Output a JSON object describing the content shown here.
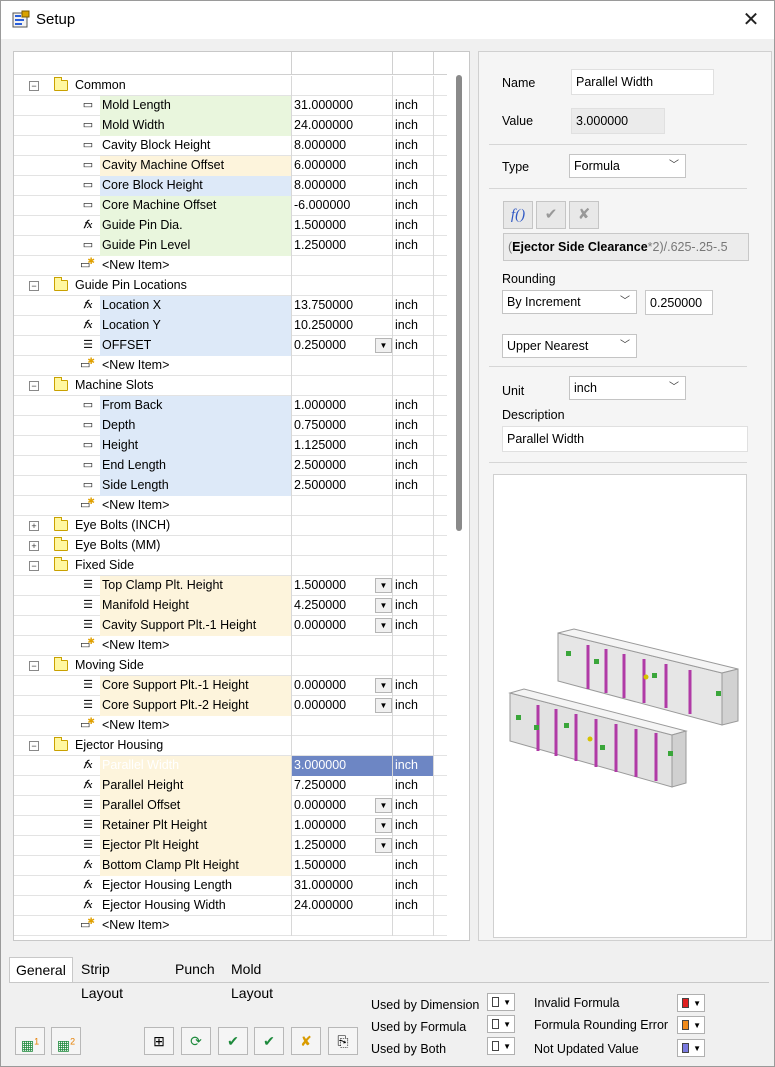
{
  "window": {
    "title": "Setup"
  },
  "grid": {
    "rows": [
      {
        "kind": "group",
        "level": 0,
        "label": "Common",
        "open": true
      },
      {
        "kind": "item",
        "label": "Mold Length",
        "value": "31.000000",
        "unit": "inch",
        "icon": "dim",
        "bg": "#e9f6dd"
      },
      {
        "kind": "item",
        "label": "Mold Width",
        "value": "24.000000",
        "unit": "inch",
        "icon": "dim",
        "bg": "#e9f6dd"
      },
      {
        "kind": "item",
        "label": "Cavity Block Height",
        "value": "8.000000",
        "unit": "inch",
        "icon": "dim",
        "bg": ""
      },
      {
        "kind": "item",
        "label": "Cavity Machine Offset",
        "value": "6.000000",
        "unit": "inch",
        "icon": "dim",
        "bg": "#fdf4dc"
      },
      {
        "kind": "item",
        "label": "Core Block Height",
        "value": "8.000000",
        "unit": "inch",
        "icon": "dim",
        "bg": "#dde9f8"
      },
      {
        "kind": "item",
        "label": "Core Machine Offset",
        "value": "-6.000000",
        "unit": "inch",
        "icon": "dim",
        "bg": "#e9f6dd"
      },
      {
        "kind": "item",
        "label": "Guide Pin Dia.",
        "value": "1.500000",
        "unit": "inch",
        "icon": "fx",
        "bg": "#e9f6dd"
      },
      {
        "kind": "item",
        "label": "Guide Pin Level",
        "value": "1.250000",
        "unit": "inch",
        "icon": "dim",
        "bg": "#e9f6dd"
      },
      {
        "kind": "new",
        "label": "<New Item>"
      },
      {
        "kind": "group",
        "label": "Guide Pin Locations",
        "open": true
      },
      {
        "kind": "item",
        "label": "Location X",
        "value": "13.750000",
        "unit": "inch",
        "icon": "fx",
        "bg": "#dde9f8"
      },
      {
        "kind": "item",
        "label": "Location Y",
        "value": "10.250000",
        "unit": "inch",
        "icon": "fx",
        "bg": "#dde9f8"
      },
      {
        "kind": "item",
        "label": "OFFSET",
        "value": "0.250000",
        "unit": "inch",
        "icon": "list",
        "bg": "#dde9f8",
        "dd": true
      },
      {
        "kind": "new",
        "label": "<New Item>"
      },
      {
        "kind": "group",
        "label": "Machine Slots",
        "open": true
      },
      {
        "kind": "item",
        "label": "From Back",
        "value": "1.000000",
        "unit": "inch",
        "icon": "dim",
        "bg": "#dde9f8"
      },
      {
        "kind": "item",
        "label": "Depth",
        "value": "0.750000",
        "unit": "inch",
        "icon": "dim",
        "bg": "#dde9f8"
      },
      {
        "kind": "item",
        "label": "Height",
        "value": "1.125000",
        "unit": "inch",
        "icon": "dim",
        "bg": "#dde9f8"
      },
      {
        "kind": "item",
        "label": "End Length",
        "value": "2.500000",
        "unit": "inch",
        "icon": "dim",
        "bg": "#dde9f8"
      },
      {
        "kind": "item",
        "label": "Side Length",
        "value": "2.500000",
        "unit": "inch",
        "icon": "dim",
        "bg": "#dde9f8"
      },
      {
        "kind": "new",
        "label": "<New Item>"
      },
      {
        "kind": "group",
        "label": "Eye Bolts (INCH)",
        "open": false
      },
      {
        "kind": "group",
        "label": "Eye Bolts (MM)",
        "open": false
      },
      {
        "kind": "group",
        "label": "Fixed Side",
        "open": true
      },
      {
        "kind": "item",
        "label": "Top Clamp Plt. Height",
        "value": "1.500000",
        "unit": "inch",
        "icon": "list",
        "bg": "#fdf4dc",
        "dd": true
      },
      {
        "kind": "item",
        "label": "Manifold Height",
        "value": "4.250000",
        "unit": "inch",
        "icon": "list",
        "bg": "#fdf4dc",
        "dd": true
      },
      {
        "kind": "item",
        "label": "Cavity Support Plt.-1  Height",
        "value": "0.000000",
        "unit": "inch",
        "icon": "list",
        "bg": "#fdf4dc",
        "dd": true
      },
      {
        "kind": "new",
        "label": "<New Item>"
      },
      {
        "kind": "group",
        "label": "Moving Side",
        "open": true
      },
      {
        "kind": "item",
        "label": "Core Support Plt.-1  Height",
        "value": "0.000000",
        "unit": "inch",
        "icon": "list",
        "bg": "#fdf4dc",
        "dd": true
      },
      {
        "kind": "item",
        "label": "Core Support Plt.-2  Height",
        "value": "0.000000",
        "unit": "inch",
        "icon": "list",
        "bg": "#fdf4dc",
        "dd": true
      },
      {
        "kind": "new",
        "label": "<New Item>"
      },
      {
        "kind": "group",
        "label": "Ejector Housing",
        "open": true
      },
      {
        "kind": "item",
        "label": "Parallel Width",
        "value": "3.000000",
        "unit": "inch",
        "icon": "fx",
        "bg": "#fdf4dc",
        "selected": true
      },
      {
        "kind": "item",
        "label": "Parallel Height",
        "value": "7.250000",
        "unit": "inch",
        "icon": "fx",
        "bg": "#fdf4dc"
      },
      {
        "kind": "item",
        "label": "Parallel Offset",
        "value": "0.000000",
        "unit": "inch",
        "icon": "list",
        "bg": "#fdf4dc",
        "dd": true
      },
      {
        "kind": "item",
        "label": "Retainer Plt Height",
        "value": "1.000000",
        "unit": "inch",
        "icon": "list",
        "bg": "#fdf4dc",
        "dd": true
      },
      {
        "kind": "item",
        "label": "Ejector Plt Height",
        "value": "1.250000",
        "unit": "inch",
        "icon": "list",
        "bg": "#fdf4dc",
        "dd": true
      },
      {
        "kind": "item",
        "label": "Bottom Clamp Plt Height",
        "value": "1.500000",
        "unit": "inch",
        "icon": "fx",
        "bg": "#fdf4dc"
      },
      {
        "kind": "item",
        "label": "Ejector Housing Length",
        "value": "31.000000",
        "unit": "inch",
        "icon": "fx",
        "bg": ""
      },
      {
        "kind": "item",
        "label": "Ejector Housing Width",
        "value": "24.000000",
        "unit": "inch",
        "icon": "fx",
        "bg": ""
      },
      {
        "kind": "new",
        "label": "<New Item>"
      }
    ]
  },
  "panel": {
    "name_label": "Name",
    "name_value": "Parallel Width",
    "value_label": "Value",
    "value_value": "3.000000",
    "type_label": "Type",
    "type_value": "Formula",
    "formula_bold": "Ejector Side Clearance",
    "formula_open": "(",
    "formula_rest": "*2)/.625-.25-.5",
    "rounding_label": "Rounding",
    "rounding_mode": "By Increment",
    "rounding_increment": "0.250000",
    "rounding_direction": "Upper Nearest",
    "unit_label": "Unit",
    "unit_value": "inch",
    "description_label": "Description",
    "description_value": "Parallel Width"
  },
  "tabs": [
    {
      "label": "General",
      "active": true
    },
    {
      "label": "Strip Layout",
      "active": false
    },
    {
      "label": "Punch",
      "active": false
    },
    {
      "label": "Mold Layout",
      "active": false
    }
  ],
  "legend": {
    "used_by_dimension": "Used by Dimension",
    "used_by_formula": "Used by Formula",
    "used_by_both": "Used by Both",
    "invalid_formula": "Invalid Formula",
    "formula_rounding_error": "Formula Rounding Error",
    "not_updated_value": "Not Updated Value",
    "colors": {
      "invalid": "#e02020",
      "rounding": "#f08a1a",
      "not_updated": "#7a7ae0",
      "dimension": "#ffffff",
      "formula": "#ffffff",
      "both": "#ffffff"
    }
  }
}
